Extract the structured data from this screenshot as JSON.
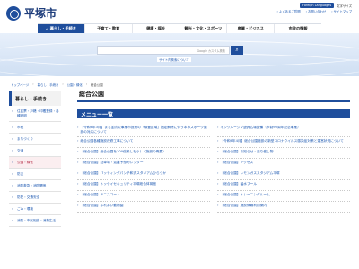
{
  "header": {
    "logo_text": "平塚市",
    "lang_label": "Foreign Languages",
    "text_size_label": "文字サイズ",
    "util_links": [
      "よくあるご質問",
      "お問い合わせ",
      "サイトマップ"
    ]
  },
  "nav": [
    {
      "icon": "house-icon",
      "glyph": "⌂",
      "label": "暮らし・手続き"
    },
    {
      "icon": "",
      "glyph": "",
      "label": "子育て・教育"
    },
    {
      "icon": "",
      "glyph": "",
      "label": "健康・福祉"
    },
    {
      "icon": "",
      "glyph": "",
      "label": "観光・文化・スポーツ"
    },
    {
      "icon": "",
      "glyph": "",
      "label": "産業・ビジネス"
    },
    {
      "icon": "",
      "glyph": "",
      "label": "市政の情報"
    }
  ],
  "search": {
    "placeholder": "Google カスタム検索",
    "button_glyph": "⌕",
    "site_link": "サイト内検索について"
  },
  "breadcrumb": [
    "トップページ",
    "暮らし・手続き",
    "公園・緑化",
    "総合公園"
  ],
  "sidebar": {
    "title": "暮らし・手続き",
    "items": [
      {
        "label": "住民票・戸籍・印鑑登録・各種証明"
      },
      {
        "label": "市税"
      },
      {
        "label": "まちづくり"
      },
      {
        "label": "交通"
      },
      {
        "label": "公園・緑化",
        "active": true
      },
      {
        "label": "防災"
      },
      {
        "label": "消防救急・消防関係"
      },
      {
        "label": "防犯・交通安全"
      },
      {
        "label": "ごみ・環境"
      },
      {
        "label": "消防・市民相談・消費生活"
      }
    ]
  },
  "main": {
    "title": "総合公園",
    "menu_title": "メニュー一覧",
    "links_left": [
      "【令和6年3月】まち並防災事業市提案の「緑豊区域」指定解除に伴う本市スポーツ施設の対応について",
      "総合公園各種施設改修工事について",
      "【総合公園】総合公園を100倍楽しもう！（施設の概要）",
      "【総合公園】駐車場・混雑予想カレンダー",
      "【総合公園】バッティングパンチ和式スタジアムひらつか",
      "【総合公園】トッケイセキュリティ平塚総合体育館",
      "【総合公園】テニスコート",
      "【総合公園】ふれあい動物園"
    ],
    "links_right": [
      "インクルーシブ遊具広場整備（市制90周年記念事業）",
      "【令和6年4月】総合公園施設の新型コロナウイルス感染症対策と運営状況について",
      "【総合公園】お知らせ・至な催し物",
      "【総合公園】アクセス",
      "【総合公園】レモンガススタジアム平塚",
      "【総合公園】猛水プール",
      "【総合公園】トレーニングルーム",
      "【総合公園】施設情報利用案内"
    ]
  }
}
